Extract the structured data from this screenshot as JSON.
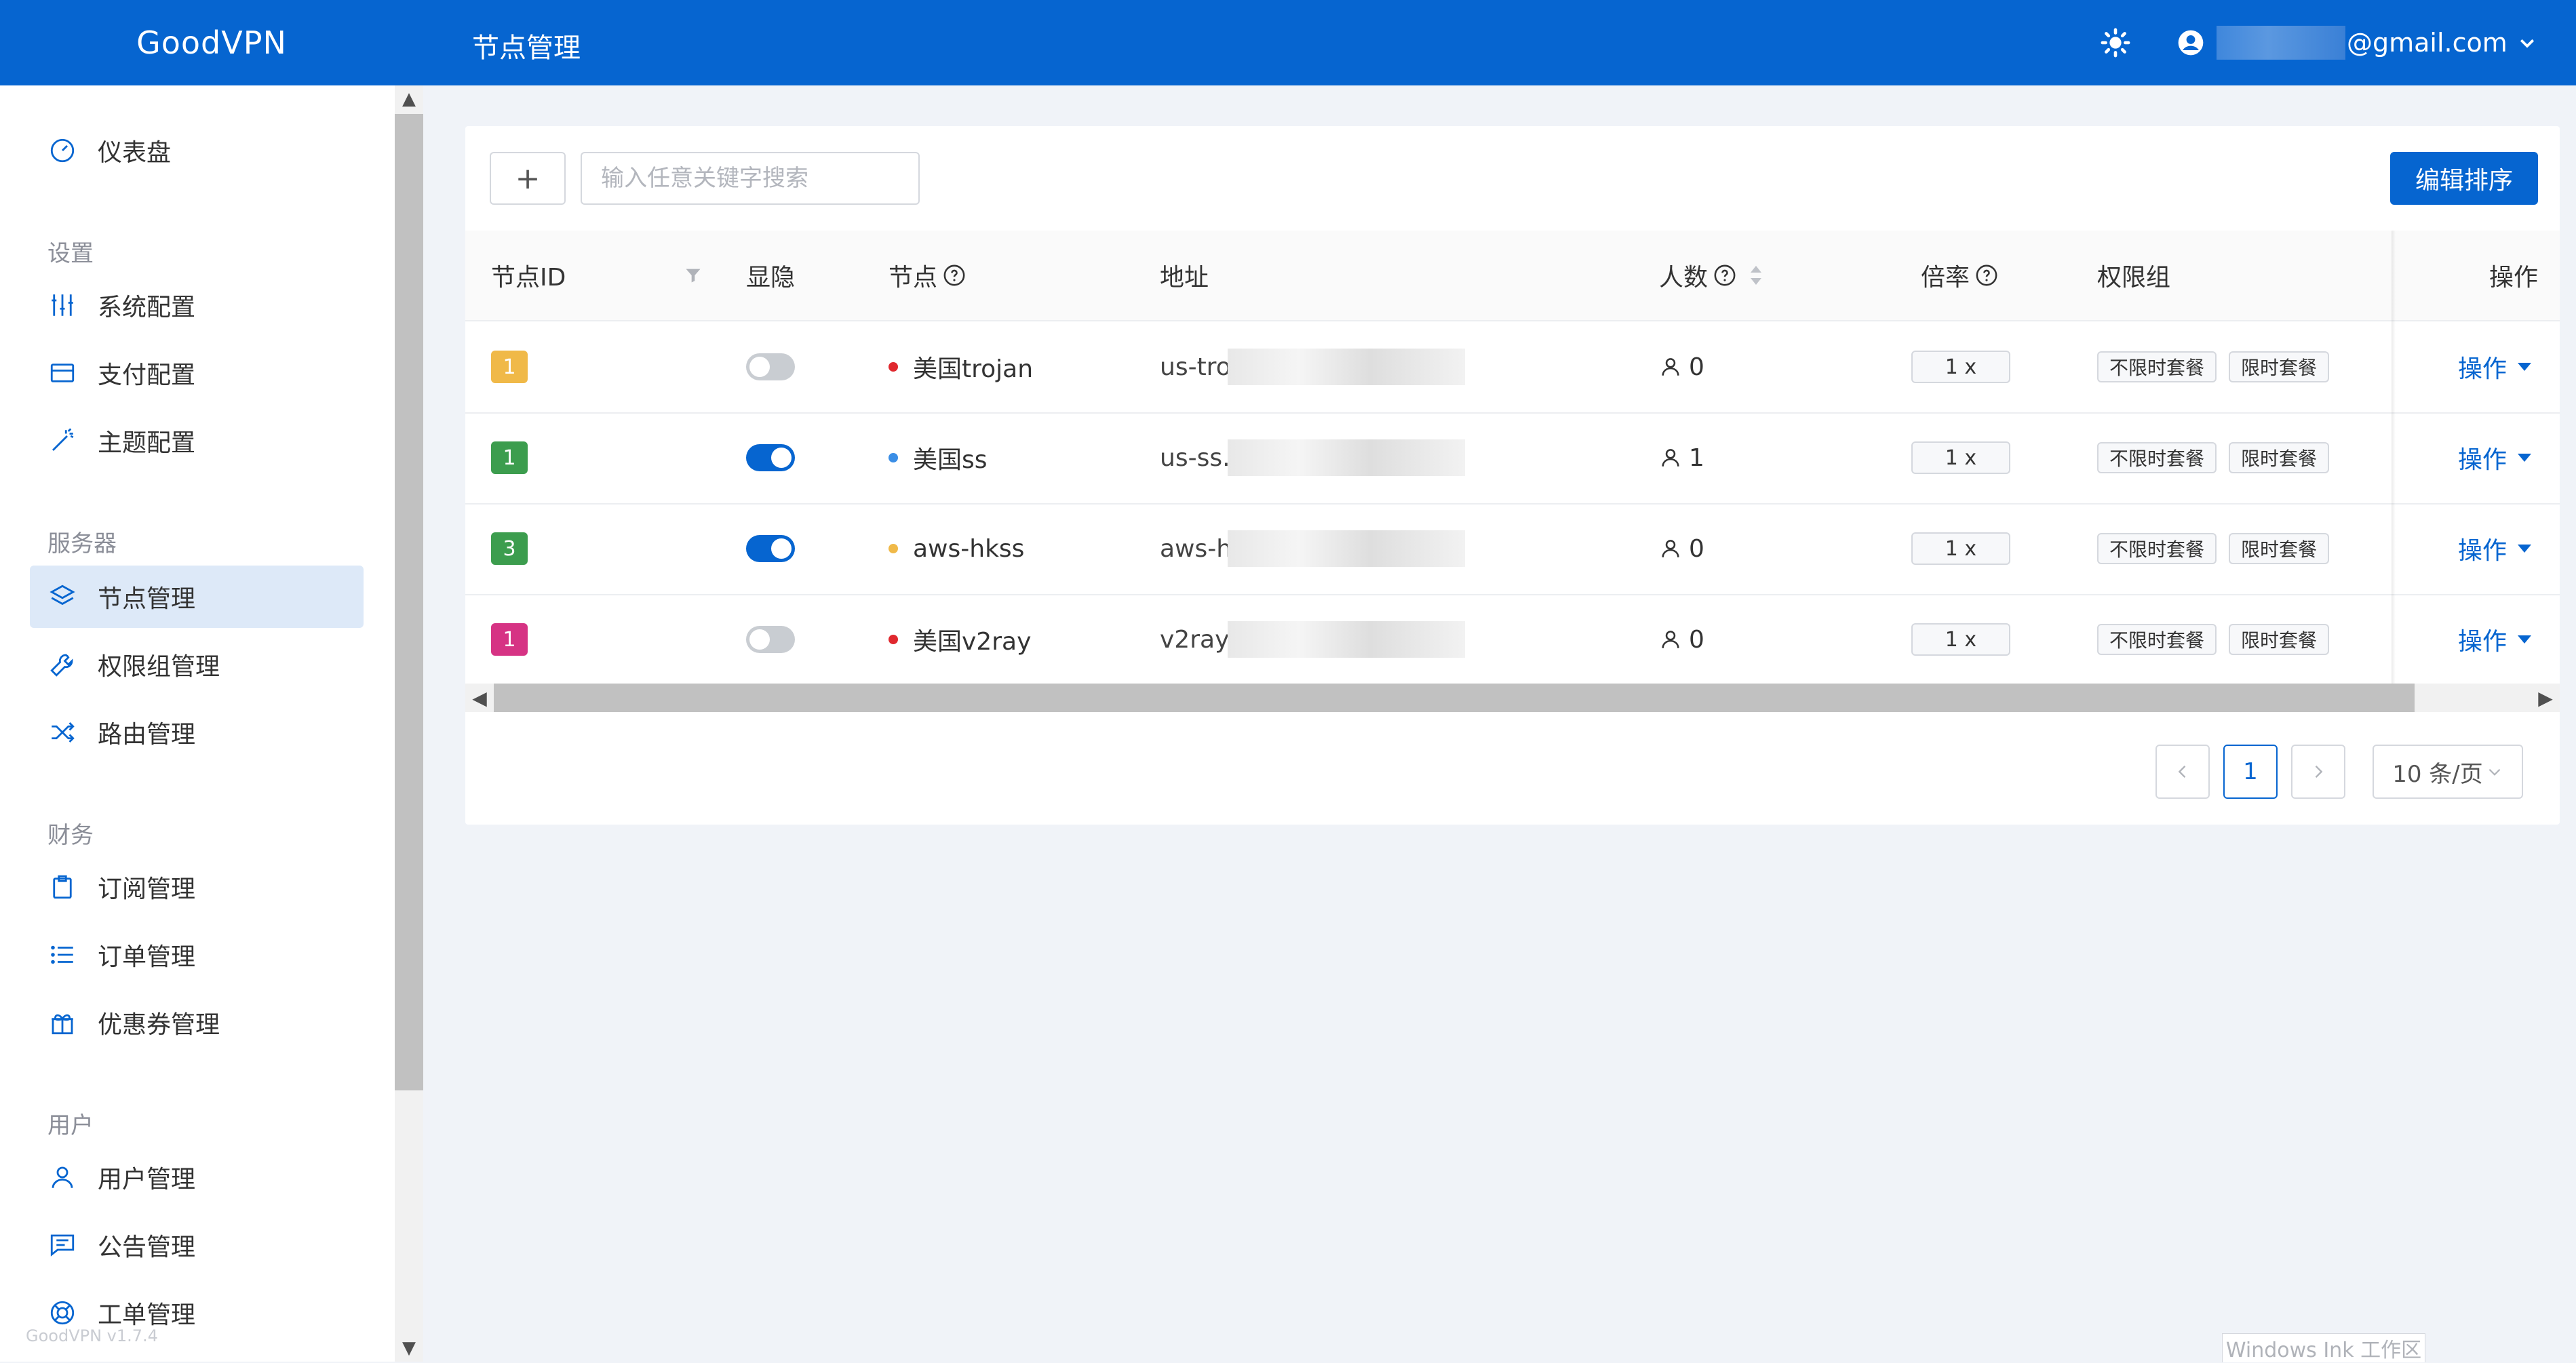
{
  "app": {
    "brand": "GoodVPN",
    "version": "GoodVPN v1.7.4"
  },
  "header": {
    "title": "节点管理",
    "user_email_suffix": "@gmail.com",
    "theme_icon": "sun-icon",
    "user_icon": "account-circle-icon"
  },
  "sidebar": {
    "dashboard": "仪表盘",
    "sections": {
      "settings": "设置",
      "server": "服务器",
      "finance": "财务",
      "users": "用户"
    },
    "items": {
      "system_config": "系统配置",
      "payment_config": "支付配置",
      "theme_config": "主题配置",
      "node_manage": "节点管理",
      "permission_group": "权限组管理",
      "route_manage": "路由管理",
      "subscription": "订阅管理",
      "orders": "订单管理",
      "coupons": "优惠券管理",
      "user_manage": "用户管理",
      "notice": "公告管理",
      "tickets": "工单管理"
    },
    "active": "node_manage"
  },
  "toolbar": {
    "add_label": "+",
    "search_placeholder": "输入任意关键字搜索",
    "edit_sort_label": "编辑排序"
  },
  "table": {
    "columns": {
      "id": "节点ID",
      "show": "显隐",
      "node": "节点",
      "address": "地址",
      "people": "人数",
      "rate": "倍率",
      "group": "权限组",
      "action": "操作"
    },
    "rows": [
      {
        "id": "1",
        "id_color": "#f0b948",
        "visible": false,
        "status_color": "#e0282e",
        "name": "美国trojan",
        "address": "us-tro",
        "people": "0",
        "rate": "1 x",
        "groups": [
          "不限时套餐",
          "限时套餐"
        ],
        "action": "操作"
      },
      {
        "id": "1",
        "id_color": "#3c9d4e",
        "visible": true,
        "status_color": "#3a8ee6",
        "name": "美国ss",
        "address": "us-ss.",
        "people": "1",
        "rate": "1 x",
        "groups": [
          "不限时套餐",
          "限时套餐"
        ],
        "action": "操作"
      },
      {
        "id": "3",
        "id_color": "#3c9d4e",
        "visible": true,
        "status_color": "#f0b948",
        "name": "aws-hkss",
        "address": "aws-h",
        "people": "0",
        "rate": "1 x",
        "groups": [
          "不限时套餐",
          "限时套餐"
        ],
        "action": "操作"
      },
      {
        "id": "1",
        "id_color": "#d63384",
        "visible": false,
        "status_color": "#e0282e",
        "name": "美国v2ray",
        "address": "v2ray.",
        "people": "0",
        "rate": "1 x",
        "groups": [
          "不限时套餐",
          "限时套餐"
        ],
        "action": "操作"
      }
    ]
  },
  "pagination": {
    "current": "1",
    "page_size": "10 条/页"
  },
  "watermark": "Windows Ink 工作区",
  "colors": {
    "primary": "#0665d0",
    "active_bg": "#dde9f8"
  }
}
